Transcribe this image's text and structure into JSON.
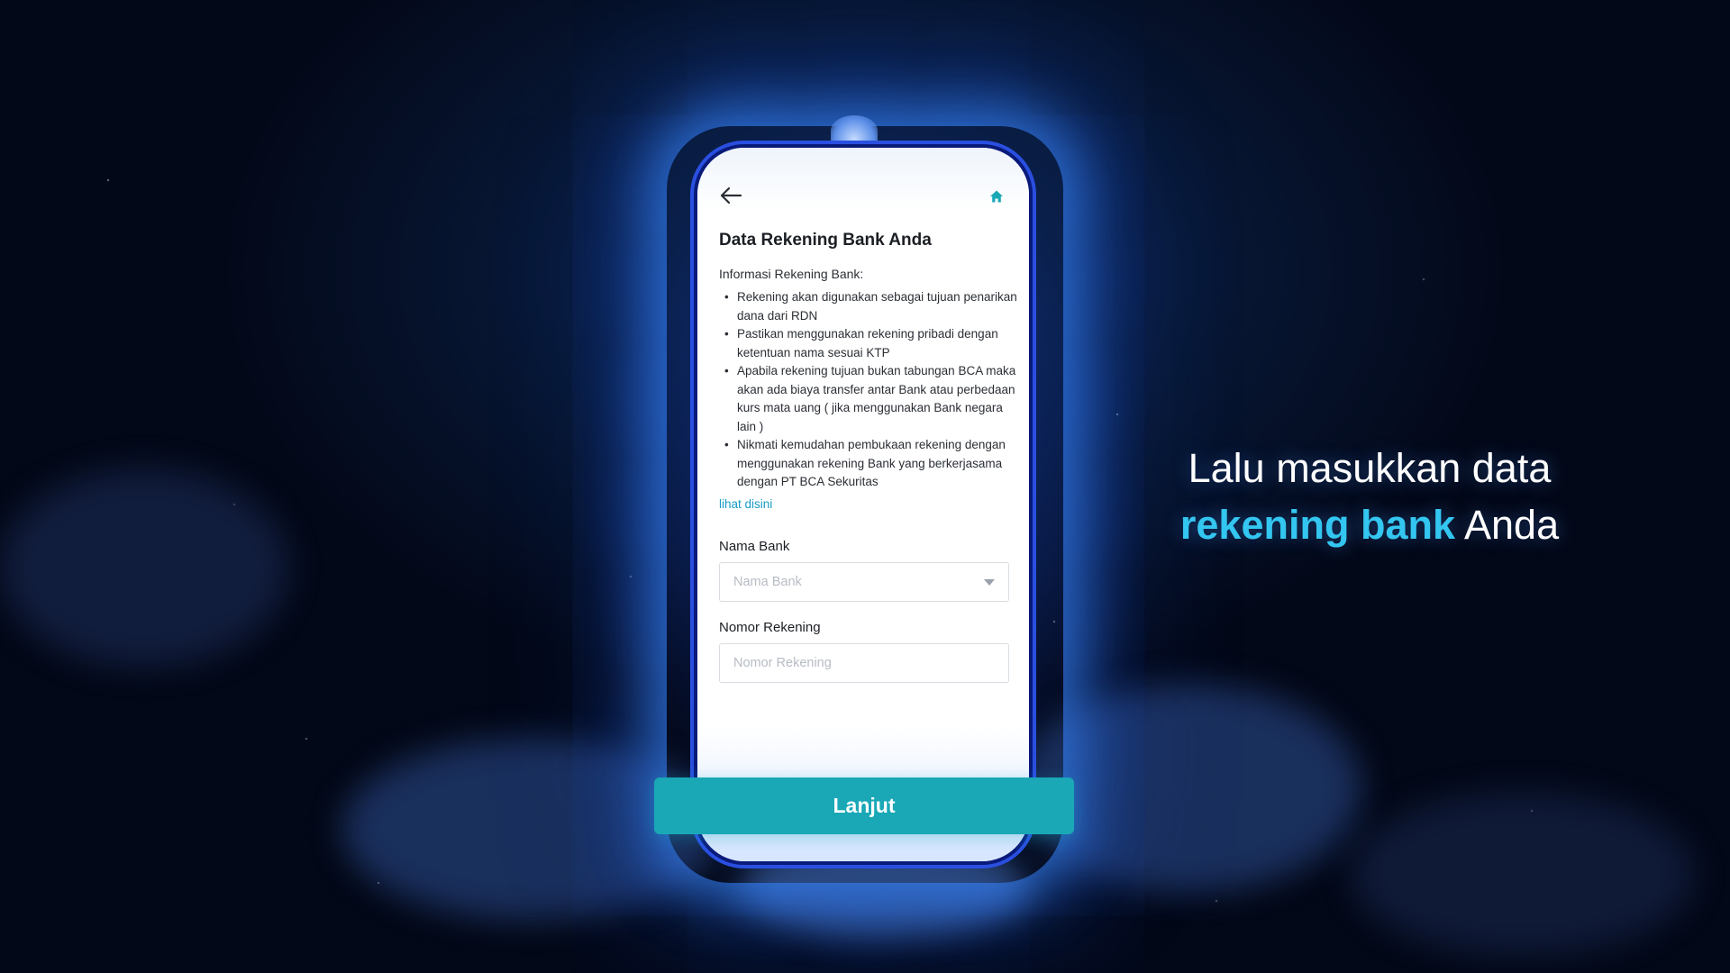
{
  "screen": {
    "nav": {
      "back_icon": "arrow-left-icon",
      "home_icon": "home-icon"
    },
    "title": "Data Rekening Bank Anda",
    "info_label": "Informasi Rekening Bank:",
    "info_items": [
      "Rekening akan digunakan sebagai tujuan penarikan dana dari RDN",
      "Pastikan menggunakan rekening pribadi dengan ketentuan nama sesuai KTP",
      "Apabila rekening tujuan bukan tabungan BCA maka akan ada biaya transfer antar Bank atau perbedaan kurs mata uang ( jika menggunakan Bank negara lain )",
      "Nikmati kemudahan pembukaan rekening dengan menggunakan rekening Bank yang berkerjasama dengan PT BCA Sekuritas"
    ],
    "link_text": "lihat disini",
    "fields": {
      "bank_name": {
        "label": "Nama Bank",
        "placeholder": "Nama Bank",
        "value": ""
      },
      "account_number": {
        "label": "Nomor Rekening",
        "placeholder": "Nomor Rekening",
        "value": ""
      }
    }
  },
  "cta": {
    "label": "Lanjut"
  },
  "tagline": {
    "line1": "Lalu masukkan data",
    "highlight": "rekening bank",
    "line2_rest": " Anda"
  },
  "colors": {
    "accent_teal": "#1aa8b7",
    "link_blue": "#1a9bc4",
    "highlight_cyan": "#33c6f0",
    "background": "#030818"
  }
}
